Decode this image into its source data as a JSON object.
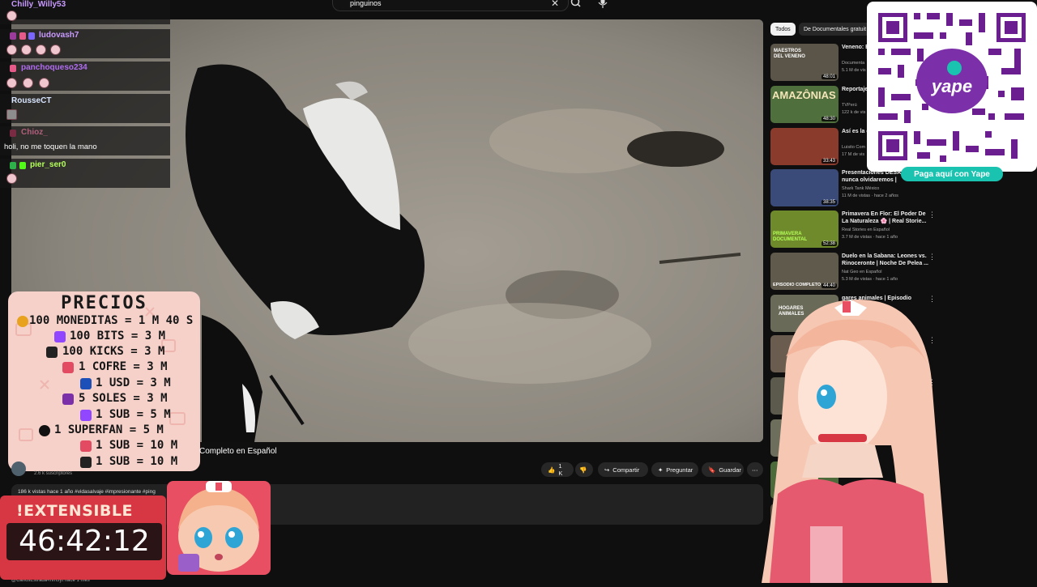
{
  "search": {
    "query": "pinguinos"
  },
  "chat": [
    {
      "user": "Chilly_Willy53",
      "color": "#c99aff",
      "message": ""
    },
    {
      "user": "ludovash7",
      "color": "#c99aff",
      "message": ""
    },
    {
      "user": "panchoqueso234",
      "color": "#b06cf0",
      "message": ""
    },
    {
      "user": "RousseCT",
      "color": "#d8e5ff",
      "message": ""
    },
    {
      "user": "Chioz_",
      "color": "#b05f7c",
      "message": "holi, no me toquen la mano"
    },
    {
      "user": "pier_ser0",
      "color": "#b4ff5a",
      "message": ""
    }
  ],
  "prices": {
    "title": "PRECIOS",
    "rows": [
      {
        "text": "100 MONEDITAS = 1 M 40 S",
        "icon": "coin-icon",
        "color": "#e8a21e"
      },
      {
        "text": "100 BITS = 3 M",
        "icon": "twitch-bits-icon",
        "color": "#9147ff"
      },
      {
        "text": "100 KICKS = 3 M",
        "icon": "kick-icon",
        "color": "#222222"
      },
      {
        "text": "1 COFRE = 3 M",
        "icon": "chest-icon",
        "color": "#e34b62"
      },
      {
        "text": "1 USD = 3 M",
        "icon": "paypal-icon",
        "color": "#1c4fb8"
      },
      {
        "text": "5 SOLES = 3 M",
        "icon": "yape-icon",
        "color": "#7b2fa8"
      },
      {
        "text": "1 SUB = 5 M",
        "icon": "twitch-sub-icon",
        "color": "#9147ff"
      },
      {
        "text": "1 SUPERFAN = 5 M",
        "icon": "tiktok-icon",
        "color": "#111111"
      },
      {
        "text": "1 SUB = 10 M",
        "icon": "gift-sub-icon",
        "color": "#e34b62"
      },
      {
        "text": "1 SUB = 10 M",
        "icon": "kick-sub-icon",
        "color": "#222222"
      }
    ]
  },
  "timer": {
    "label": "!EXTENSIBLE",
    "value": "46:42:12"
  },
  "video": {
    "title": "Completo en Español",
    "subscribers": "2.6 k suscriptores",
    "likes": "1 K",
    "share": "Compartir",
    "ask": "Preguntar",
    "save": "Guardar",
    "description_meta": "186 k vistas  hace 1 año  #vidasalvaje #impresionante #ping",
    "comment_author": "@CarlosEstrada-mm3yt  hace 1 mes"
  },
  "chips": [
    "Todos",
    "De Documentales gratuit"
  ],
  "recommendations": [
    {
      "title": "Veneno: E Naturalez",
      "channel": "Documenta",
      "meta": "5.1 M de vis",
      "duration": "48:01",
      "thumb_text": "MAESTROS DEL VENENO",
      "thumb_color": "#5a5548"
    },
    {
      "title": "Reportaje el valle de",
      "channel": "TVPerú",
      "meta": "122 k de vis",
      "duration": "48:30",
      "thumb_text": "AMAZÔNIAS",
      "thumb_color": "#4f6f3d"
    },
    {
      "title": "Así es la de todo el",
      "channel": "Luisito Com",
      "meta": "17 M de vis",
      "duration": "33:43",
      "thumb_text": "",
      "thumb_color": "#8a3b2c"
    },
    {
      "title": "Presentaciones DESAS que nunca olvidaremos |",
      "channel": "Shark Tank México",
      "meta": "11 M de vistas · hace 2 años",
      "duration": "38:35",
      "thumb_text": "",
      "thumb_color": "#3a4b7a"
    },
    {
      "title": "Primavera En Flor: El Poder De La Naturaleza 🌸 | Real Storie...",
      "channel": "Real Stories en Español",
      "meta": "3.7 M de vistas · hace 1 año",
      "duration": "52:38",
      "thumb_text": "PRIMAVERA DOCUMENTAL",
      "thumb_color": "#6f8a2a"
    },
    {
      "title": "Duelo en la Sabana: Leones vs. Rinoceronte | Noche De Pelea ...",
      "channel": "Nat Geo en Español",
      "meta": "5.3 M de vistas · hace 1 año",
      "duration": "44:40",
      "thumb_text": "EPISODIO COMPLETO",
      "thumb_color": "#5f5a4b"
    },
    {
      "title": "gares animales | Episodio",
      "channel": "",
      "meta": "",
      "duration": "",
      "thumb_text": "HOGARES ANIMALES",
      "thumb_color": "#6a6a58"
    }
  ],
  "qr": {
    "button_label": "Paga aquí con Yape",
    "brand": "yape"
  }
}
